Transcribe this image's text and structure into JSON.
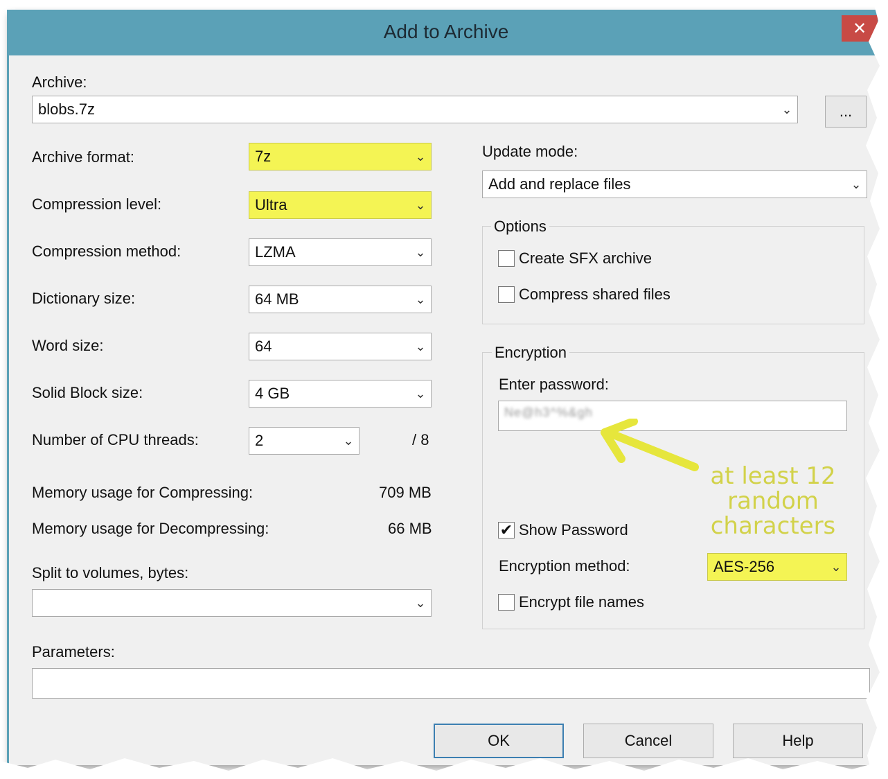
{
  "window": {
    "title": "Add to Archive",
    "close_glyph": "✕"
  },
  "archive": {
    "label": "Archive:",
    "value": "blobs.7z",
    "browse": "..."
  },
  "left": {
    "archive_format": {
      "label": "Archive format:",
      "value": "7z"
    },
    "compression_level": {
      "label": "Compression level:",
      "value": "Ultra"
    },
    "compression_method": {
      "label": "Compression method:",
      "value": "LZMA"
    },
    "dictionary_size": {
      "label": "Dictionary size:",
      "value": "64 MB"
    },
    "word_size": {
      "label": "Word size:",
      "value": "64"
    },
    "solid_block_size": {
      "label": "Solid Block size:",
      "value": "4 GB"
    },
    "cpu_threads": {
      "label": "Number of CPU threads:",
      "value": "2",
      "max": "/ 8"
    },
    "memory_compress": {
      "label": "Memory usage for Compressing:",
      "value": "709 MB"
    },
    "memory_decompress": {
      "label": "Memory usage for Decompressing:",
      "value": "66 MB"
    },
    "split_volumes": {
      "label": "Split to volumes, bytes:",
      "value": ""
    },
    "parameters": {
      "label": "Parameters:",
      "value": ""
    }
  },
  "right": {
    "update_mode": {
      "label": "Update mode:",
      "value": "Add and replace files"
    },
    "options": {
      "title": "Options",
      "create_sfx": {
        "label": "Create SFX archive",
        "checked": false
      },
      "compress_shared": {
        "label": "Compress shared files",
        "checked": false
      }
    },
    "encryption": {
      "title": "Encryption",
      "password_label": "Enter password:",
      "password_value": "Ne@h3^%&gh",
      "show_password": {
        "label": "Show Password",
        "checked": true,
        "check_glyph": "✔"
      },
      "method_label": "Encryption method:",
      "method_value": "AES-256",
      "encrypt_names": {
        "label": "Encrypt file names",
        "checked": false
      }
    }
  },
  "annotation": {
    "text_line1": "at least 12",
    "text_line2": "random",
    "text_line3": "characters",
    "color": "#d2d24a"
  },
  "buttons": {
    "ok": "OK",
    "cancel": "Cancel",
    "help": "Help"
  },
  "icons": {
    "dropdown": "chevron-down-icon",
    "arrow": "arrow-icon"
  },
  "colors": {
    "titlebar": "#5ba1b7",
    "highlight": "#f4f454",
    "close": "#c84a45"
  }
}
